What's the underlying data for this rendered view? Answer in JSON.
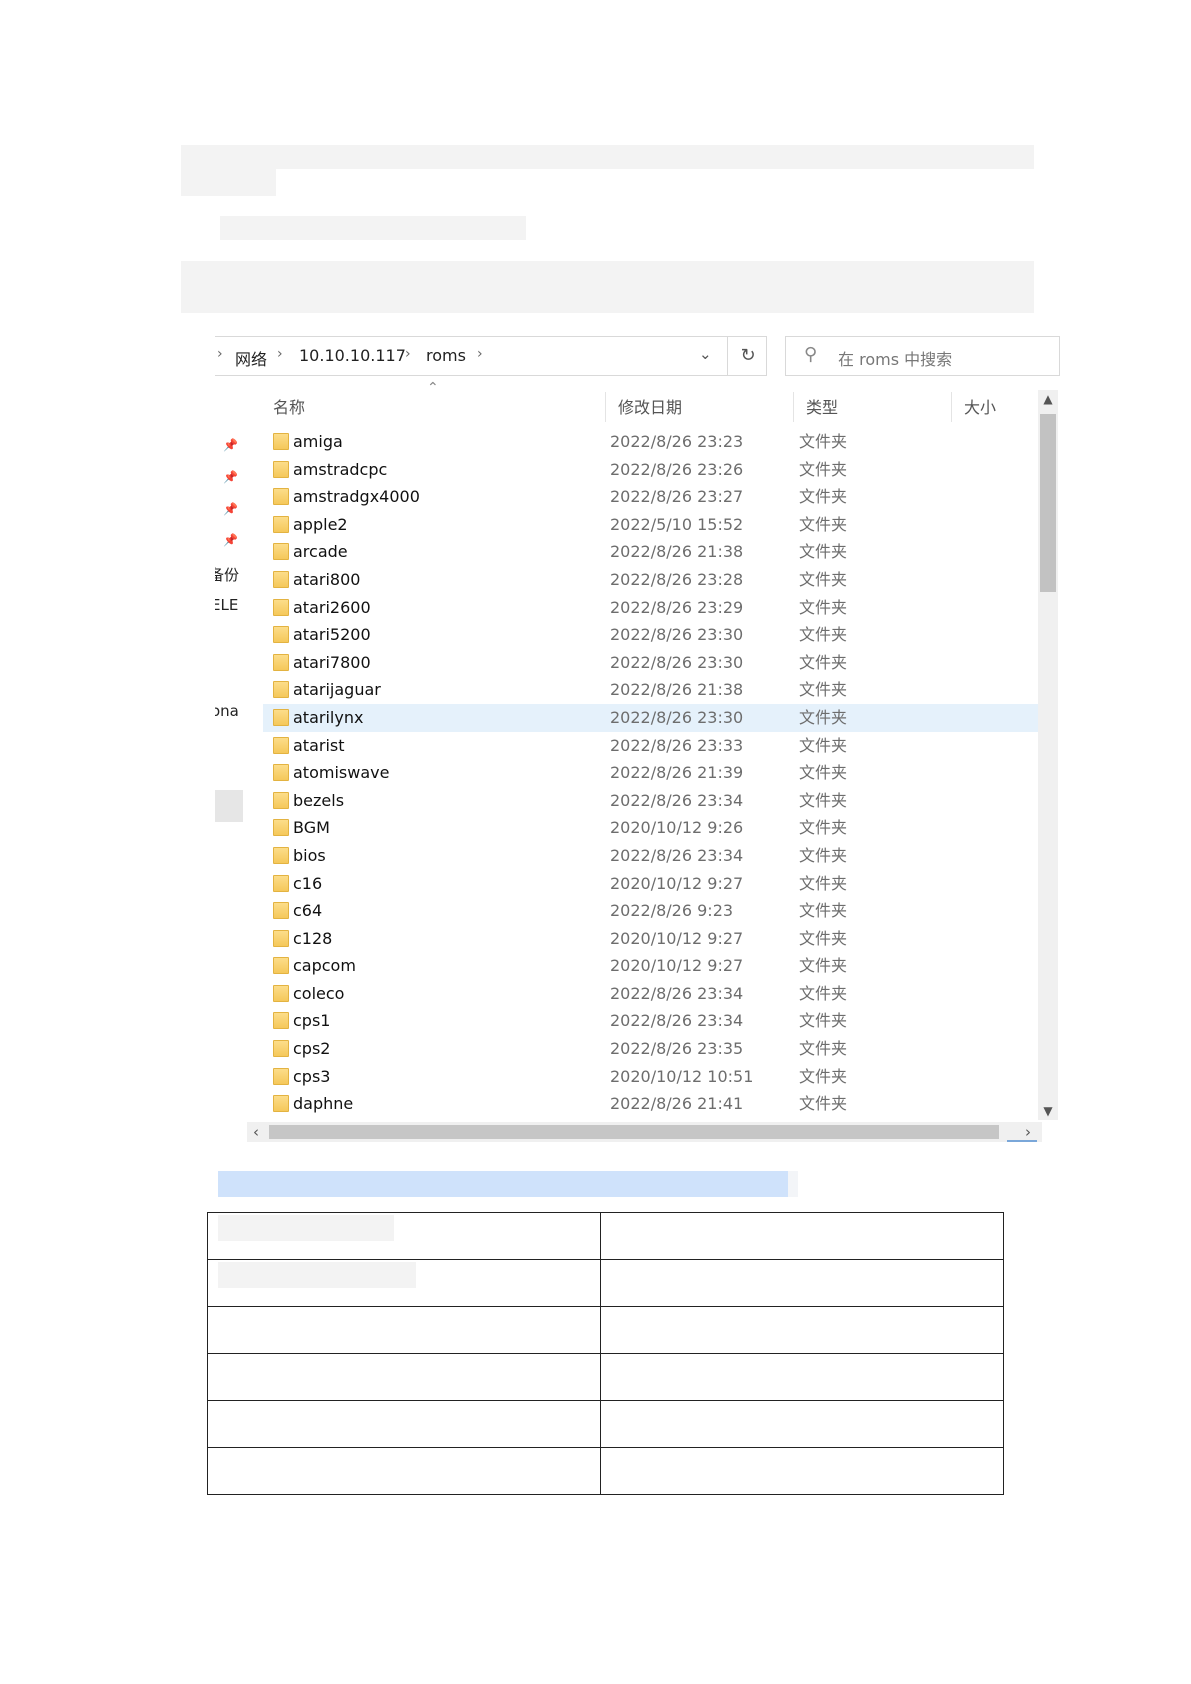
{
  "address": {
    "crumbs": [
      "网络",
      "10.10.10.117",
      "roms"
    ],
    "separator": "›",
    "dropdown_icon": "chevron-down-icon",
    "refresh_icon": "refresh-icon"
  },
  "search": {
    "placeholder": "在 roms 中搜索",
    "icon": "search-icon"
  },
  "nav": {
    "fragments": [
      "备份",
      "ELE",
      "ona"
    ]
  },
  "columns": {
    "name": "名称",
    "date": "修改日期",
    "type": "类型",
    "size": "大小"
  },
  "files": [
    {
      "name": "amiga",
      "date": "2022/8/26 23:23",
      "type": "文件夹"
    },
    {
      "name": "amstradcpc",
      "date": "2022/8/26 23:26",
      "type": "文件夹"
    },
    {
      "name": "amstradgx4000",
      "date": "2022/8/26 23:27",
      "type": "文件夹"
    },
    {
      "name": "apple2",
      "date": "2022/5/10 15:52",
      "type": "文件夹"
    },
    {
      "name": "arcade",
      "date": "2022/8/26 21:38",
      "type": "文件夹"
    },
    {
      "name": "atari800",
      "date": "2022/8/26 23:28",
      "type": "文件夹"
    },
    {
      "name": "atari2600",
      "date": "2022/8/26 23:29",
      "type": "文件夹"
    },
    {
      "name": "atari5200",
      "date": "2022/8/26 23:30",
      "type": "文件夹"
    },
    {
      "name": "atari7800",
      "date": "2022/8/26 23:30",
      "type": "文件夹"
    },
    {
      "name": "atarijaguar",
      "date": "2022/8/26 21:38",
      "type": "文件夹"
    },
    {
      "name": "atarilynx",
      "date": "2022/8/26 23:30",
      "type": "文件夹",
      "selected": true
    },
    {
      "name": "atarist",
      "date": "2022/8/26 23:33",
      "type": "文件夹"
    },
    {
      "name": "atomiswave",
      "date": "2022/8/26 21:39",
      "type": "文件夹"
    },
    {
      "name": "bezels",
      "date": "2022/8/26 23:34",
      "type": "文件夹"
    },
    {
      "name": "BGM",
      "date": "2020/10/12 9:26",
      "type": "文件夹"
    },
    {
      "name": "bios",
      "date": "2022/8/26 23:34",
      "type": "文件夹"
    },
    {
      "name": "c16",
      "date": "2020/10/12 9:27",
      "type": "文件夹"
    },
    {
      "name": "c64",
      "date": "2022/8/26 9:23",
      "type": "文件夹"
    },
    {
      "name": "c128",
      "date": "2020/10/12 9:27",
      "type": "文件夹"
    },
    {
      "name": "capcom",
      "date": "2020/10/12 9:27",
      "type": "文件夹"
    },
    {
      "name": "coleco",
      "date": "2022/8/26 23:34",
      "type": "文件夹"
    },
    {
      "name": "cps1",
      "date": "2022/8/26 23:34",
      "type": "文件夹"
    },
    {
      "name": "cps2",
      "date": "2022/8/26 23:35",
      "type": "文件夹"
    },
    {
      "name": "cps3",
      "date": "2020/10/12 10:51",
      "type": "文件夹"
    },
    {
      "name": "daphne",
      "date": "2022/8/26 21:41",
      "type": "文件夹"
    }
  ],
  "table": {
    "rows": 6,
    "cols": 2
  }
}
